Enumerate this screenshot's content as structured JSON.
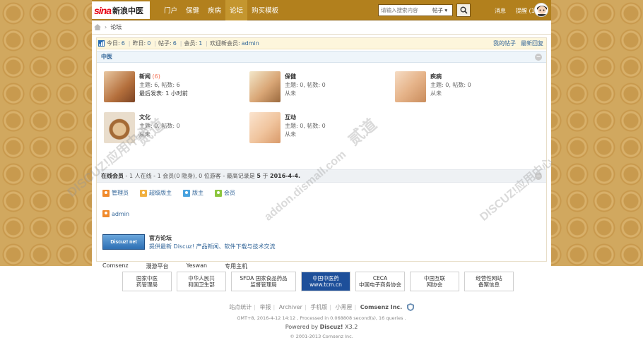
{
  "logo": {
    "mark": "sina",
    "text": "新浪中医"
  },
  "nav": {
    "items": [
      {
        "label": "门户",
        "active": false
      },
      {
        "label": "保健",
        "active": false
      },
      {
        "label": "疾病",
        "active": false
      },
      {
        "label": "论坛",
        "active": true
      },
      {
        "label": "购买模板",
        "active": false
      }
    ]
  },
  "search": {
    "placeholder": "请输入搜索内容",
    "type": "帖子 ▾"
  },
  "user": {
    "messages": "消息",
    "reminders": "提醒 (1)"
  },
  "breadcrumb": {
    "current": "论坛",
    "sep": "›"
  },
  "stats": {
    "today_label": "今日:",
    "today": "6",
    "yesterday_label": "昨日:",
    "yesterday": "0",
    "posts_label": "帖子:",
    "posts": "6",
    "members_label": "会员:",
    "members": "1",
    "newest_label": "欢迎新会员:",
    "newest": "admin",
    "my_posts": "我的帖子",
    "latest_replies": "最新回复"
  },
  "category": {
    "name": "中医",
    "collapse": "−"
  },
  "boards": [
    {
      "name": "新闻",
      "new": "(6)",
      "stats": "主题: 6, 帖数: 6",
      "last": "最后发表: 1 小时前"
    },
    {
      "name": "保健",
      "new": "",
      "stats": "主题: 0, 帖数: 0",
      "last": "从未"
    },
    {
      "name": "疾病",
      "new": "",
      "stats": "主题: 0, 帖数: 0",
      "last": "从未"
    },
    {
      "name": "文化",
      "new": "",
      "stats": "主题: 0, 帖数: 0",
      "last": "从未"
    },
    {
      "name": "互动",
      "new": "",
      "stats": "主题: 0, 帖数: 0",
      "last": "从未"
    }
  ],
  "online": {
    "label": "在线会员",
    "text": " - 1 人在线 - 1 会员(0 隐身), 0 位游客 - 最高记录是 ",
    "record": "5",
    "on": " 于 ",
    "date": "2016-4-4."
  },
  "legend": [
    {
      "label": "管理员",
      "color": "#f08a2c"
    },
    {
      "label": "超级版主",
      "color": "#f1b040"
    },
    {
      "label": "版主",
      "color": "#4aa3df"
    },
    {
      "label": "会员",
      "color": "#8cc63f"
    }
  ],
  "member": {
    "name": "admin"
  },
  "partner": {
    "logo": "Discuz! net",
    "title": "官方论坛",
    "desc": "提供最新 Discuz! 产品新闻、软件下载与技术交流"
  },
  "friends": [
    "Comsenz",
    "漫游平台",
    "Yeswan",
    "专用主机"
  ],
  "watermark": {
    "a": "DISCUZ!应用中心",
    "b": "addon.dismall.com",
    "c": "贰道"
  },
  "badges": [
    {
      "text": "国家中医\n药管理局"
    },
    {
      "text": "中华人民共\n和国卫生部"
    },
    {
      "text": "SFDA 国家食品药品\n监督管理局"
    },
    {
      "text": "中国中医药\nwww.tcm.cn"
    },
    {
      "text": "CECA\n中国电子商务协会"
    },
    {
      "text": "中国互联\n网协会"
    },
    {
      "text": "经营性网站\n备案信息"
    }
  ],
  "footer": {
    "links": [
      "站点统计",
      "举报",
      "Archiver",
      "手机版",
      "小黑屋"
    ],
    "company": "Comsenz Inc.",
    "gmt": "GMT+8, 2016-4-12 14:12 , Processed in 0.068808 second(s), 16 queries .",
    "powered_prefix": "Powered by ",
    "powered_brand": "Discuz!",
    "powered_version": " X3.2",
    "copyright": "© 2001-2013 Comsenz Inc."
  }
}
